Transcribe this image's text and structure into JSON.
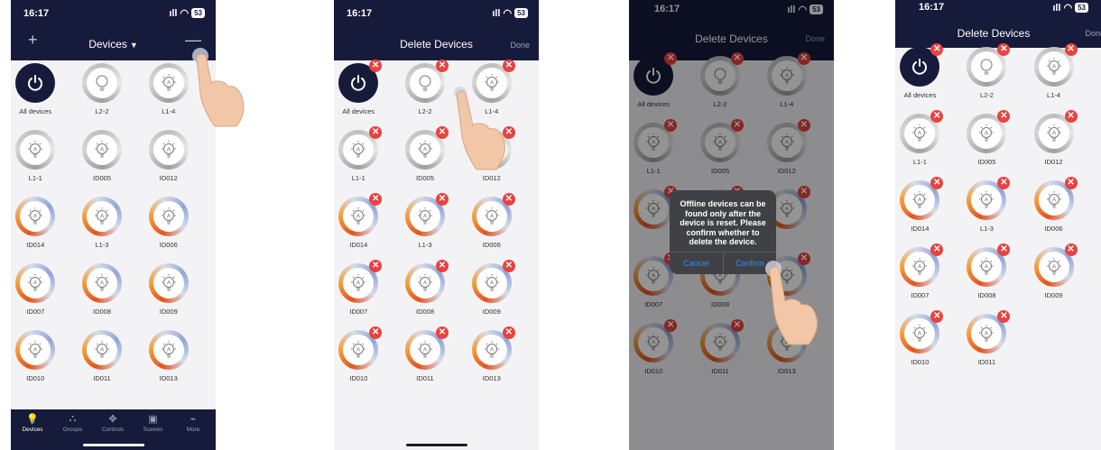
{
  "phone1": {
    "status_time": "16:17",
    "battery": "53",
    "nav_title": "Devices",
    "devices": [
      {
        "label": "All devices",
        "kind": "power"
      },
      {
        "label": "L2-2",
        "kind": "grey"
      },
      {
        "label": "L1-4",
        "kind": "grey"
      },
      {
        "label": "L1-1",
        "kind": "grey"
      },
      {
        "label": "ID005",
        "kind": "grey"
      },
      {
        "label": "ID012",
        "kind": "grey"
      },
      {
        "label": "ID014",
        "kind": "warm"
      },
      {
        "label": "L1-3",
        "kind": "warm"
      },
      {
        "label": "ID006",
        "kind": "warm"
      },
      {
        "label": "ID007",
        "kind": "warm"
      },
      {
        "label": "ID008",
        "kind": "warm"
      },
      {
        "label": "ID009",
        "kind": "warm"
      },
      {
        "label": "ID010",
        "kind": "warm"
      },
      {
        "label": "ID011",
        "kind": "warm"
      },
      {
        "label": "ID013",
        "kind": "warm"
      }
    ],
    "tabs": [
      {
        "label": "Devices",
        "icon": "bulb-icon",
        "glyph": "💡"
      },
      {
        "label": "Groups",
        "icon": "groups-icon",
        "glyph": "⛬"
      },
      {
        "label": "Controls",
        "icon": "controls-icon",
        "glyph": "✥"
      },
      {
        "label": "Scenes",
        "icon": "scenes-icon",
        "glyph": "▣"
      },
      {
        "label": "More",
        "icon": "more-icon",
        "glyph": "⌁"
      }
    ]
  },
  "phone2": {
    "status_time": "16:17",
    "battery": "53",
    "nav_title": "Delete Devices",
    "done_label": "Done",
    "devices": [
      {
        "label": "All devices",
        "kind": "power"
      },
      {
        "label": "L2-2",
        "kind": "grey"
      },
      {
        "label": "L1-4",
        "kind": "grey"
      },
      {
        "label": "L1-1",
        "kind": "grey"
      },
      {
        "label": "ID005",
        "kind": "grey"
      },
      {
        "label": "ID012",
        "kind": "grey"
      },
      {
        "label": "ID014",
        "kind": "warm"
      },
      {
        "label": "L1-3",
        "kind": "warm"
      },
      {
        "label": "ID006",
        "kind": "warm"
      },
      {
        "label": "ID007",
        "kind": "warm"
      },
      {
        "label": "ID008",
        "kind": "warm"
      },
      {
        "label": "ID009",
        "kind": "warm"
      },
      {
        "label": "ID010",
        "kind": "warm"
      },
      {
        "label": "ID011",
        "kind": "warm"
      },
      {
        "label": "ID013",
        "kind": "warm"
      }
    ]
  },
  "phone3": {
    "status_time": "16:17",
    "battery": "53",
    "nav_title": "Delete Devices",
    "done_label": "Done",
    "devices": [
      {
        "label": "All devices",
        "kind": "power"
      },
      {
        "label": "L2-2",
        "kind": "grey"
      },
      {
        "label": "L1-4",
        "kind": "grey"
      },
      {
        "label": "L1-1",
        "kind": "grey"
      },
      {
        "label": "ID005",
        "kind": "grey"
      },
      {
        "label": "ID012",
        "kind": "grey"
      },
      {
        "label": "",
        "kind": "warm"
      },
      {
        "label": "",
        "kind": "warm"
      },
      {
        "label": "",
        "kind": "warm"
      },
      {
        "label": "ID007",
        "kind": "warm"
      },
      {
        "label": "ID008",
        "kind": "warm"
      },
      {
        "label": "",
        "kind": "warm"
      },
      {
        "label": "ID010",
        "kind": "warm"
      },
      {
        "label": "ID011",
        "kind": "warm"
      },
      {
        "label": "ID013",
        "kind": "warm"
      }
    ],
    "dialog": {
      "message": "Offline devices can be found only after the device is reset. Please confirm whether to delete the device.",
      "cancel": "Cancel",
      "confirm": "Confirm"
    }
  },
  "phone4": {
    "status_time": "16:17",
    "battery": "53",
    "nav_title": "Delete Devices",
    "done_label": "Done",
    "devices": [
      {
        "label": "All devices",
        "kind": "power"
      },
      {
        "label": "L2-2",
        "kind": "grey"
      },
      {
        "label": "L1-4",
        "kind": "grey"
      },
      {
        "label": "L1-1",
        "kind": "grey"
      },
      {
        "label": "ID005",
        "kind": "grey"
      },
      {
        "label": "ID012",
        "kind": "grey"
      },
      {
        "label": "ID014",
        "kind": "warm"
      },
      {
        "label": "L1-3",
        "kind": "warm"
      },
      {
        "label": "ID006",
        "kind": "warm"
      },
      {
        "label": "ID007",
        "kind": "warm"
      },
      {
        "label": "ID008",
        "kind": "warm"
      },
      {
        "label": "ID009",
        "kind": "warm"
      },
      {
        "label": "ID010",
        "kind": "warm"
      },
      {
        "label": "ID011",
        "kind": "warm"
      }
    ]
  },
  "colors": {
    "navbar": "#161b3b",
    "delete_badge": "#e9423f",
    "confirm_blue": "#2f8cff"
  }
}
